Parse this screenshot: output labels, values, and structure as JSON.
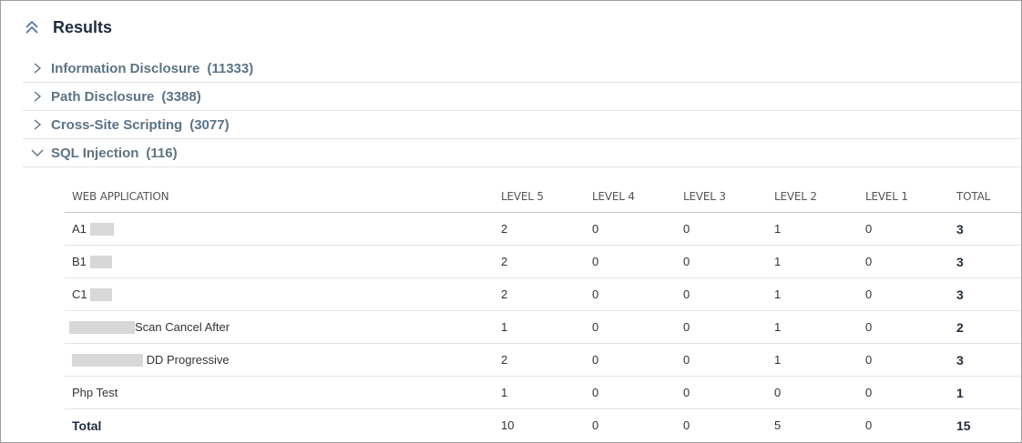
{
  "panel": {
    "title": "Results"
  },
  "categories": [
    {
      "name": "Information Disclosure",
      "count": "(11333)",
      "expanded": false
    },
    {
      "name": "Path Disclosure",
      "count": "(3388)",
      "expanded": false
    },
    {
      "name": "Cross-Site Scripting",
      "count": "(3077)",
      "expanded": false
    },
    {
      "name": "SQL Injection",
      "count": "(116)",
      "expanded": true
    }
  ],
  "table": {
    "headers": [
      "WEB APPLICATION",
      "LEVEL 5",
      "LEVEL 4",
      "LEVEL 3",
      "LEVEL 2",
      "LEVEL 1",
      "TOTAL"
    ],
    "rows": [
      {
        "app_prefix": "A1",
        "app_suffix": "",
        "values": [
          "2",
          "0",
          "0",
          "1",
          "0"
        ],
        "total": "3"
      },
      {
        "app_prefix": "B1",
        "app_suffix": "",
        "values": [
          "2",
          "0",
          "0",
          "1",
          "0"
        ],
        "total": "3"
      },
      {
        "app_prefix": "C1",
        "app_suffix": "",
        "values": [
          "2",
          "0",
          "0",
          "1",
          "0"
        ],
        "total": "3"
      },
      {
        "app_prefix": "",
        "app_suffix": "Scan Cancel After",
        "values": [
          "1",
          "0",
          "0",
          "1",
          "0"
        ],
        "total": "2"
      },
      {
        "app_prefix": "",
        "app_suffix": "DD Progressive",
        "values": [
          "2",
          "0",
          "0",
          "1",
          "0"
        ],
        "total": "3"
      },
      {
        "app_prefix": "Php Test",
        "app_suffix": "",
        "values": [
          "1",
          "0",
          "0",
          "0",
          "0"
        ],
        "total": "1"
      }
    ],
    "total_row": {
      "label": "Total",
      "values": [
        "10",
        "0",
        "0",
        "5",
        "0"
      ],
      "total": "15"
    }
  },
  "icons": {
    "collapse": "double-chevron-up-icon",
    "collapsed": "chevron-right-icon",
    "expanded": "chevron-down-icon"
  },
  "colors": {
    "accent": "#5b7384",
    "title": "#1f2d3d",
    "icon": "#4a6fa5"
  }
}
